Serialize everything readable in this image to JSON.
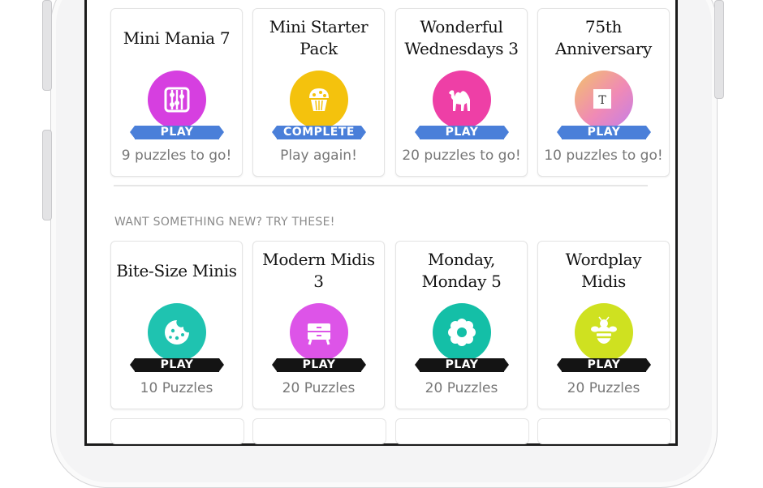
{
  "section_header": "WANT SOMETHING NEW? TRY THESE!",
  "colors": {
    "play_ribbon_blue": "#4a7fd9",
    "play_ribbon_black": "#141414",
    "mini_mania": "#d63fe0",
    "starter_pack": "#f4c20d",
    "wonderful_wednesdays": "#ee3fa6",
    "bite_size": "#1fc3b0",
    "modern_midis": "#dd54e8",
    "monday_monday": "#14bfa7",
    "wordplay_midis": "#cfe120"
  },
  "current_packs": [
    {
      "title": "Mini Mania 7",
      "icon": "abacus-icon",
      "ribbon": "PLAY",
      "subtitle": "9 puzzles to go!"
    },
    {
      "title": "Mini Starter Pack",
      "icon": "cupcake-icon",
      "ribbon": "COMPLETE",
      "subtitle": "Play again!"
    },
    {
      "title": "Wonderful Wednesdays 3",
      "icon": "camel-icon",
      "ribbon": "PLAY",
      "subtitle": "20 puzzles to go!"
    },
    {
      "title": "75th Anniversary",
      "icon": "anniversary-icon",
      "ribbon": "PLAY",
      "subtitle": "10 puzzles to go!"
    }
  ],
  "new_packs": [
    {
      "title": "Bite-Size Minis",
      "icon": "cookie-icon",
      "ribbon": "PLAY",
      "subtitle": "10 Puzzles"
    },
    {
      "title": "Modern Midis 3",
      "icon": "nightstand-icon",
      "ribbon": "PLAY",
      "subtitle": "20 Puzzles"
    },
    {
      "title": "Monday, Monday 5",
      "icon": "flower-icon",
      "ribbon": "PLAY",
      "subtitle": "20 Puzzles"
    },
    {
      "title": "Wordplay Midis",
      "icon": "bee-icon",
      "ribbon": "PLAY",
      "subtitle": "20 Puzzles"
    }
  ]
}
